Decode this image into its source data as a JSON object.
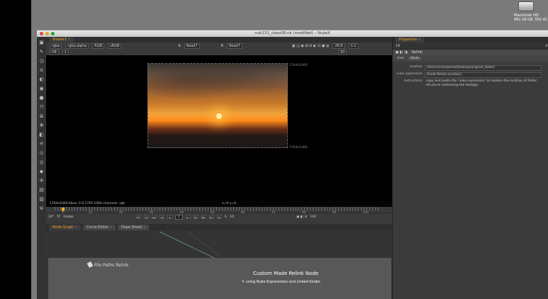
{
  "desktop": {
    "drive_label": "Macintosh HD",
    "drive_sublabel": "981.58 GB, 552.42 GB free"
  },
  "window": {
    "title": "nuk231_class08.nk (modified) – NukeX"
  },
  "viewer": {
    "tab_label": "Viewer1",
    "channels": "rgba",
    "channel_layer": "rgba.alpha",
    "display": "RGB",
    "lut": "sRGB",
    "input_a_label": "A",
    "input_a": "Read7",
    "input_b_label": "B",
    "input_b": "Read7",
    "frame_val": "f/8",
    "gain_val": "1",
    "zoom": "20",
    "ratio": "26:9",
    "proxy": "1:1",
    "res_label_top": "1764x1060",
    "res_label_bottom": "1764x1060",
    "info_left": "1764x1060  bbox: 0 0 1764 1060 channels: rgb",
    "info_coords": "x=0 y=0"
  },
  "timeline": {
    "ticks": [
      "1",
      "10",
      "20",
      "30",
      "40",
      "50",
      "60",
      "70",
      "80",
      "90",
      "100"
    ],
    "fps_label": "24*",
    "tf_label": "TF",
    "range_mode": "Global",
    "current_frame": "1",
    "step": "10",
    "end_frame": "100"
  },
  "bottom_tabs": [
    {
      "label": "Node Graph"
    },
    {
      "label": "Curve Editor"
    },
    {
      "label": "Dope Sheet"
    }
  ],
  "graph": {
    "backdrop_label": "File Paths Relink",
    "node_title": "Custom Made Relink Node",
    "node_subtitle": "using Nuke Expressions and Linked Knobs"
  },
  "properties": {
    "tab_label": "Properties",
    "node_count": "16",
    "node_name": "Relink",
    "subtabs": [
      {
        "label": "User"
      },
      {
        "label": "Node"
      }
    ],
    "knobs": [
      {
        "label": "location",
        "value": "/Users/victorperez/Desktop/original_folder/"
      },
      {
        "label": "nuke expression",
        "value": "[knob Relink.location]"
      },
      {
        "label": "instructions",
        "value": "copy and paste the 'nuke expression' to replace the location of folder structure containing the footage."
      }
    ]
  }
}
